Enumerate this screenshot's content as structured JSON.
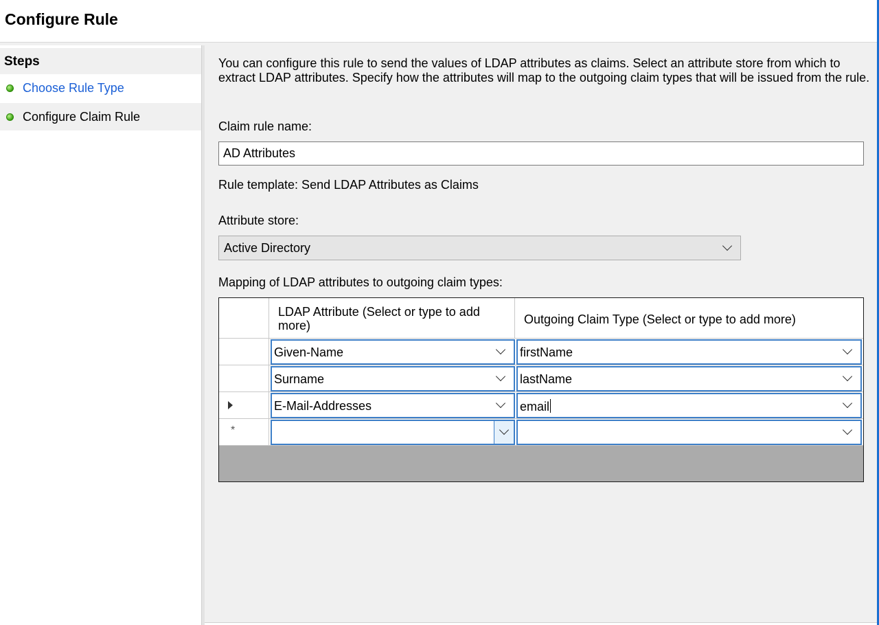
{
  "window": {
    "title": "Configure Rule"
  },
  "sidebar": {
    "heading": "Steps",
    "steps": [
      {
        "label": "Choose Rule Type",
        "state": "link"
      },
      {
        "label": "Configure Claim Rule",
        "state": "current"
      }
    ]
  },
  "main": {
    "description": "You can configure this rule to send the values of LDAP attributes as claims. Select an attribute store from which to extract LDAP attributes. Specify how the attributes will map to the outgoing claim types that will be issued from the rule.",
    "claim_rule_name_label": "Claim rule name:",
    "claim_rule_name_value": "AD Attributes",
    "rule_template": "Rule template: Send LDAP Attributes as Claims",
    "attribute_store_label": "Attribute store:",
    "attribute_store_value": "Active Directory",
    "mapping_label": "Mapping of LDAP attributes to outgoing claim types:",
    "mapping": {
      "columns": [
        "LDAP Attribute (Select or type to add more)",
        "Outgoing Claim Type (Select or type to add more)"
      ],
      "rows": [
        {
          "ldap": "Given-Name",
          "claim": "firstName"
        },
        {
          "ldap": "Surname",
          "claim": "lastName"
        },
        {
          "ldap": "E-Mail-Addresses",
          "claim": "email"
        },
        {
          "ldap": "",
          "claim": ""
        }
      ],
      "new_row_marker": "*"
    }
  },
  "colors": {
    "accent": "#1a6fd1",
    "link": "#1a5fd6",
    "cell_border": "#3d7fc8",
    "grid_bg": "#ababab"
  }
}
